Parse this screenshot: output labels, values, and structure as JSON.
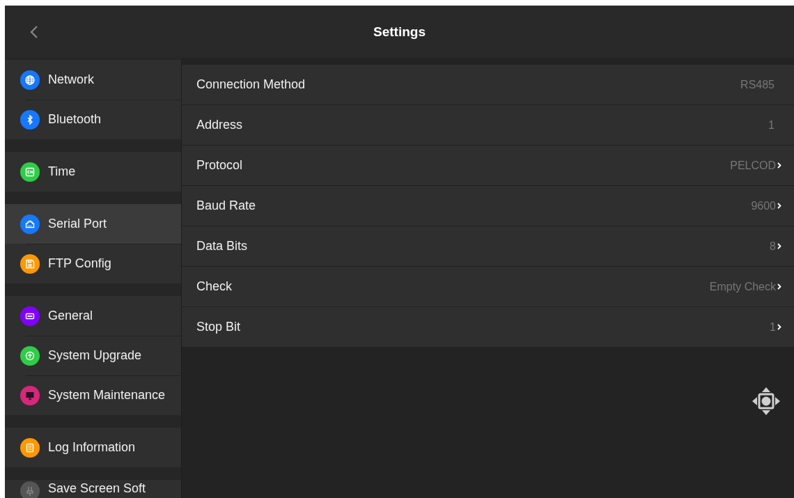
{
  "header": {
    "title": "Settings"
  },
  "sidebar": {
    "groups": [
      {
        "items": [
          {
            "label": "Network",
            "kind": "globe",
            "color": "#1677ff",
            "selected": false
          },
          {
            "label": "Bluetooth",
            "kind": "bluetooth",
            "color": "#1677ff",
            "selected": false
          }
        ]
      },
      {
        "items": [
          {
            "label": "Time",
            "kind": "en",
            "color": "#2ecc47",
            "selected": false
          }
        ]
      },
      {
        "items": [
          {
            "label": "Serial Port",
            "kind": "port",
            "color": "#1677ff",
            "selected": true
          },
          {
            "label": "FTP Config",
            "kind": "floppy",
            "color": "#ff9800",
            "selected": false
          }
        ]
      },
      {
        "items": [
          {
            "label": "General",
            "kind": "card",
            "color": "#8000ff",
            "selected": false
          },
          {
            "label": "System Upgrade",
            "kind": "upload",
            "color": "#2ecc47",
            "selected": false
          },
          {
            "label": "System Maintenance",
            "kind": "monitor",
            "color": "#d6287a",
            "selected": false
          }
        ]
      },
      {
        "items": [
          {
            "label": "Log Information",
            "kind": "list",
            "color": "#ff9800",
            "selected": false
          }
        ]
      },
      {
        "items": [
          {
            "label": "Save Screen Soft",
            "kind": "plug",
            "color": "#555555",
            "selected": false
          }
        ]
      }
    ]
  },
  "settings": [
    {
      "label": "Connection Method",
      "value": "RS485",
      "chevron": false
    },
    {
      "label": "Address",
      "value": "1",
      "chevron": false
    },
    {
      "label": "Protocol",
      "value": "PELCOD",
      "chevron": true
    },
    {
      "label": "Baud Rate",
      "value": "9600",
      "chevron": true
    },
    {
      "label": "Data Bits",
      "value": "8",
      "chevron": true
    },
    {
      "label": "Check",
      "value": "Empty Check",
      "chevron": true
    },
    {
      "label": "Stop Bit",
      "value": "1",
      "chevron": true
    }
  ]
}
